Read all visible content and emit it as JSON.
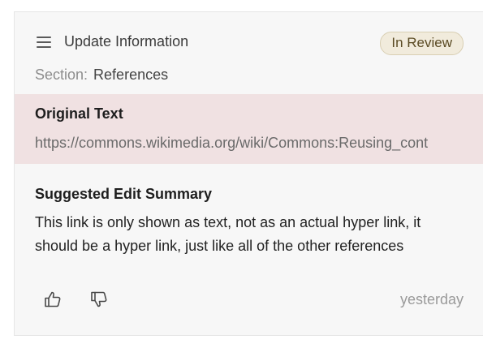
{
  "header": {
    "menu_icon": "hamburger-menu-icon",
    "title": "Update Information",
    "status_badge": "In Review"
  },
  "section": {
    "label": "Section:",
    "value": "References"
  },
  "original": {
    "heading": "Original Text",
    "text": "https://commons.wikimedia.org/wiki/Commons:Reusing_cont"
  },
  "suggestion": {
    "heading": "Suggested Edit Summary",
    "body": "This link is only shown as text, not as an actual hyper link, it should be a hyper link, just like all of the other references"
  },
  "footer": {
    "thumbs_up_icon": "thumbs-up-icon",
    "thumbs_down_icon": "thumbs-down-icon",
    "timestamp": "yesterday"
  },
  "colors": {
    "card_background": "#f7f7f7",
    "original_background": "#f0e1e2",
    "badge_background": "#f1ebdc",
    "badge_text": "#5a4a23"
  }
}
